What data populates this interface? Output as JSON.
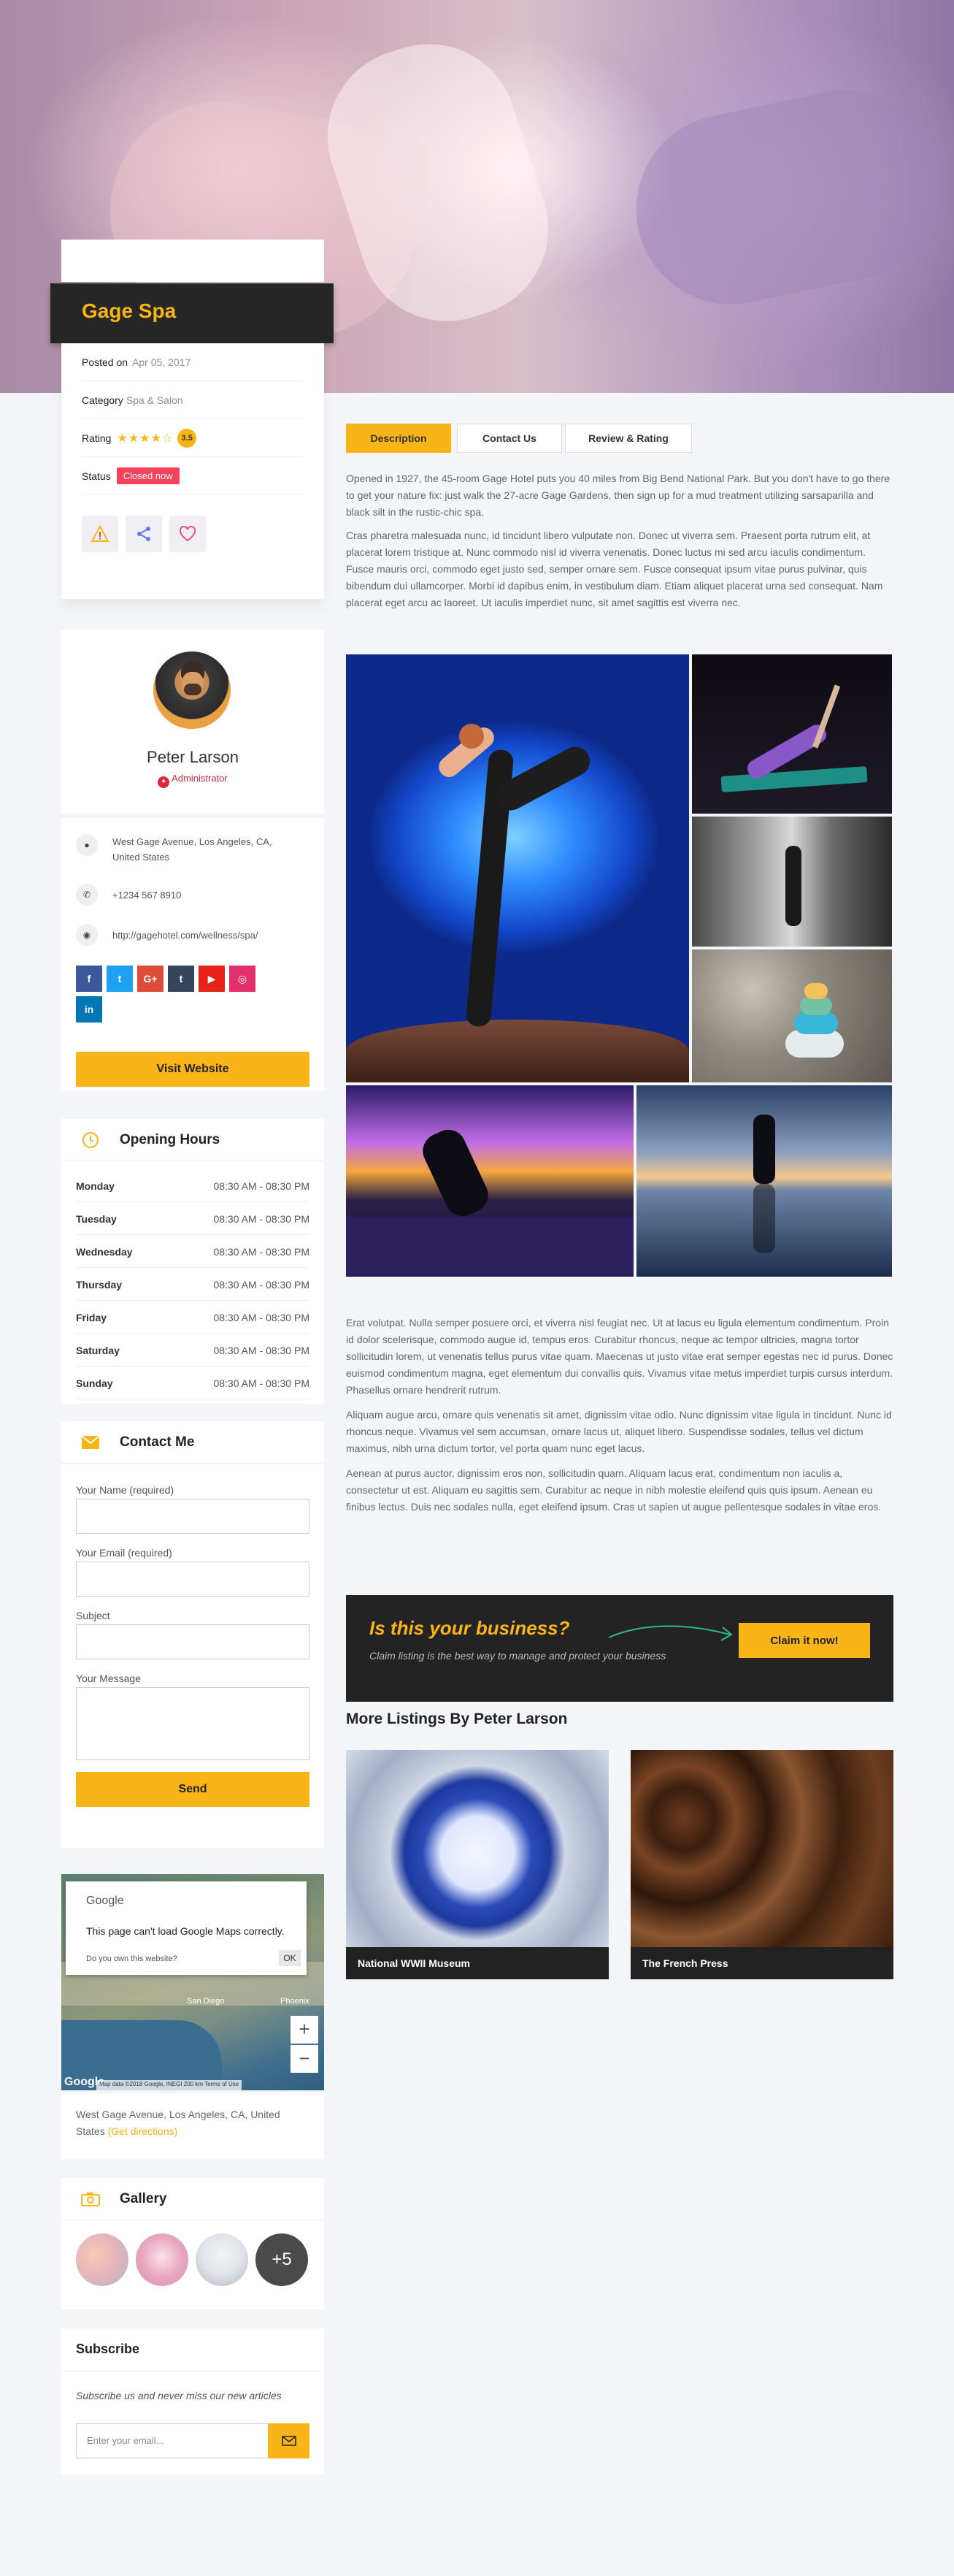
{
  "listing": {
    "title": "Gage Spa",
    "posted_label": "Posted on",
    "posted_date": "Apr 05, 2017",
    "category_label": "Category",
    "category_value": "Spa & Salon",
    "rating_label": "Rating",
    "rating_stars": "★★★★☆",
    "rating_value": "3.5",
    "status_label": "Status",
    "status_value": "Closed now"
  },
  "owner": {
    "name": "Peter Larson",
    "role": "Administrator"
  },
  "contact": {
    "address": "West Gage Avenue, Los Angeles, CA, United States",
    "phone": "+1234 567 8910",
    "website": "http://gagehotel.com/wellness/spa/",
    "visit_label": "Visit Website"
  },
  "social": [
    {
      "label": "f",
      "color": "#3b5998"
    },
    {
      "label": "t",
      "color": "#1da1f2"
    },
    {
      "label": "G+",
      "color": "#dd4b39"
    },
    {
      "label": "t",
      "color": "#35465c"
    },
    {
      "label": "▶",
      "color": "#e62117"
    },
    {
      "label": "◎",
      "color": "#e1306c"
    },
    {
      "label": "in",
      "color": "#0077b5"
    }
  ],
  "hours": {
    "title": "Opening Hours",
    "days": [
      {
        "day": "Monday",
        "time": "08:30 AM - 08:30 PM"
      },
      {
        "day": "Tuesday",
        "time": "08:30 AM - 08:30 PM"
      },
      {
        "day": "Wednesday",
        "time": "08:30 AM - 08:30 PM"
      },
      {
        "day": "Thursday",
        "time": "08:30 AM - 08:30 PM"
      },
      {
        "day": "Friday",
        "time": "08:30 AM - 08:30 PM"
      },
      {
        "day": "Saturday",
        "time": "08:30 AM - 08:30 PM"
      },
      {
        "day": "Sunday",
        "time": "08:30 AM - 08:30 PM"
      }
    ]
  },
  "contact_form": {
    "title": "Contact Me",
    "name_label": "Your Name (required)",
    "email_label": "Your Email (required)",
    "subject_label": "Subject",
    "message_label": "Your Message",
    "send_label": "Send"
  },
  "map": {
    "logo": "Google",
    "error": "This page can't load Google Maps correctly.",
    "own_question": "Do you own this website?",
    "ok_label": "OK",
    "plus": "+",
    "minus": "−",
    "footer_logo": "Google",
    "footer_text": "Map data ©2018 Google, INEGI",
    "scale": "200 km",
    "terms": "Terms of Use",
    "city1": "San Diego",
    "city2": "Phoenix",
    "address": "West Gage Avenue, Los Angeles, CA, United States",
    "directions": "(Get directions)"
  },
  "gallery": {
    "title": "Gallery",
    "more": "+5"
  },
  "subscribe": {
    "title": "Subscribe",
    "text": "Subscribe us and never miss our new articles",
    "placeholder": "Enter your email..."
  },
  "tabs": [
    {
      "label": "Description",
      "color": "#f9b417"
    },
    {
      "label": "Contact Us"
    },
    {
      "label": "Review & Rating"
    }
  ],
  "description": {
    "p1": "Opened in 1927, the 45-room Gage Hotel puts you 40 miles from Big Bend National Park. But you don't have to go there to get your nature fix: just walk the 27-acre Gage Gardens, then sign up for a mud treatment utilizing sarsaparilla and black silt in the rustic-chic spa.",
    "p2": "Cras pharetra malesuada nunc, id tincidunt libero vulputate non. Donec ut viverra sem. Praesent porta rutrum elit, at placerat lorem tristique at. Nunc commodo nisl id viverra venenatis. Donec luctus mi sed arcu iaculis condimentum. Fusce mauris orci, commodo eget justo sed, semper ornare sem. Fusce consequat ipsum vitae purus pulvinar, quis bibendum dui ullamcorper. Morbi id dapibus enim, in vestibulum diam. Etiam aliquet placerat urna sed consequat. Nam placerat eget arcu ac laoreet. Ut iaculis imperdiet nunc, sit amet sagittis est viverra nec.",
    "p3": "Erat volutpat. Nulla semper posuere orci, et viverra nisl feugiat nec. Ut at lacus eu ligula elementum condimentum. Proin id dolor scelerisque, commodo augue id, tempus eros. Curabitur rhoncus, neque ac tempor ultricies, magna tortor sollicitudin lorem, ut venenatis tellus purus vitae quam. Maecenas ut justo vitae erat semper egestas nec id purus. Donec euismod condimentum magna, eget elementum dui convallis quis. Vivamus vitae metus imperdiet turpis cursus interdum. Phasellus ornare hendrerit rutrum.",
    "p4": "Aliquam augue arcu, ornare quis venenatis sit amet, dignissim vitae odio. Nunc dignissim vitae ligula in tincidunt. Nunc id rhoncus neque. Vivamus vel sem accumsan, ornare lacus ut, aliquet libero. Suspendisse sodales, tellus vel dictum maximus, nibh urna dictum tortor, vel porta quam nunc eget lacus.",
    "p5": "Aenean at purus auctor, dignissim eros non, sollicitudin quam. Aliquam lacus erat, condimentum non iaculis a, consectetur ut est. Aliquam eu sagittis sem. Curabitur ac neque in nibh molestie eleifend quis quis ipsum. Aenean eu finibus lectus. Duis nec sodales nulla, eget eleifend ipsum. Cras ut sapien ut augue pellentesque sodales in vitae eros."
  },
  "claim": {
    "title": "Is this your business?",
    "text": "Claim listing is the best way to manage and protect your business",
    "button": "Claim it now!"
  },
  "more": {
    "title": "More Listings By Peter Larson",
    "items": [
      {
        "name": "National WWII Museum"
      },
      {
        "name": "The French Press"
      }
    ]
  }
}
